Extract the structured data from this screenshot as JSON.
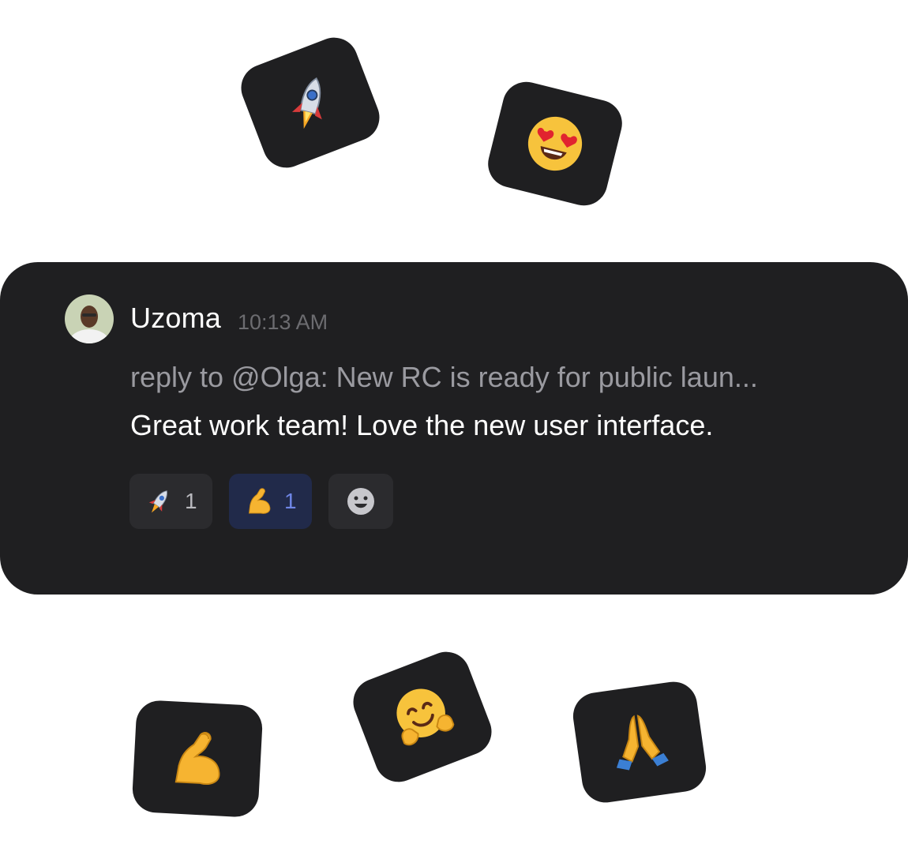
{
  "message": {
    "author": "Uzoma",
    "time": "10:13 AM",
    "reply_preview": "reply to @Olga: New RC is ready for public laun...",
    "text": "Great work team! Love the new user interface."
  },
  "reactions": [
    {
      "emoji": "rocket-icon",
      "count": "1",
      "active": false
    },
    {
      "emoji": "flexed-biceps-icon",
      "count": "1",
      "active": true
    }
  ],
  "floating_emojis": [
    "rocket-icon",
    "heart-eyes-icon",
    "flexed-biceps-icon",
    "hugging-face-icon",
    "folded-hands-icon"
  ],
  "colors": {
    "card": "#1f1f21",
    "reaction": "#2b2b2e",
    "reaction_active": "#212a4a",
    "accent": "#6f86e6"
  }
}
